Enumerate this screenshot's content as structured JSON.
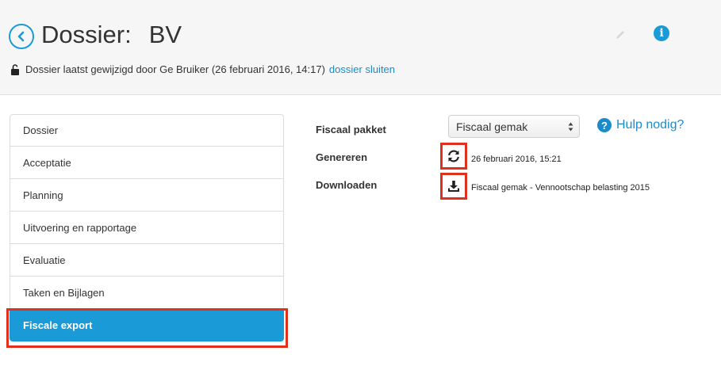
{
  "header": {
    "title": "Dossier:",
    "subtitle": "BV",
    "last_modified": "Dossier laatst gewijzigd door Ge Bruiker (26 februari 2016, 14:17)",
    "close_link": "dossier sluiten"
  },
  "icons": {
    "back": "chevron-left-circle-icon",
    "edit": "pencil-icon",
    "info": "info-icon",
    "lock": "unlocked-icon",
    "refresh": "refresh-icon",
    "download": "download-icon"
  },
  "colors": {
    "accent": "#1a9bd7",
    "highlight": "#e0301e"
  },
  "sidebar": {
    "items": [
      {
        "label": "Dossier"
      },
      {
        "label": "Acceptatie"
      },
      {
        "label": "Planning"
      },
      {
        "label": "Uitvoering en rapportage"
      },
      {
        "label": "Evaluatie"
      },
      {
        "label": "Taken en Bijlagen"
      },
      {
        "label": "Fiscale export"
      }
    ],
    "active_index": 6
  },
  "export": {
    "package_label": "Fiscaal pakket",
    "package_selected": "Fiscaal gemak",
    "generate_label": "Genereren",
    "generate_value": "26 februari 2016, 15:21",
    "download_label": "Downloaden",
    "download_value": "Fiscaal gemak - Vennootschap belasting 2015",
    "help_text": "Hulp nodig?"
  }
}
